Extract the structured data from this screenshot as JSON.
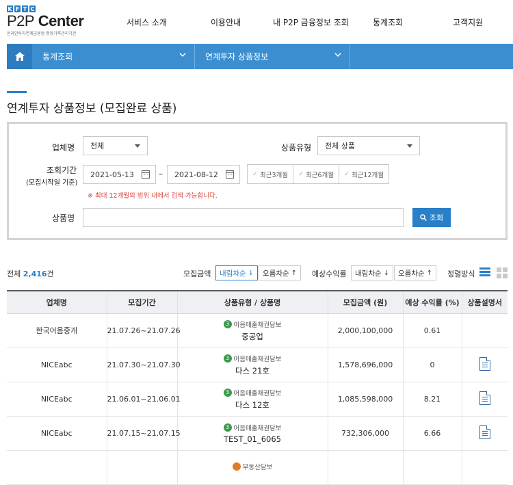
{
  "logo": {
    "top": "KFTC",
    "main_p2p": "P2P",
    "main_center": "Center",
    "sub": "온라인투자연계금융업 중앙기록관리기관"
  },
  "gnb": [
    "서비스 소개",
    "이용안내",
    "내 P2P 금융정보 조회",
    "통계조회",
    "고객지원"
  ],
  "subnav": {
    "menu1": "통계조회",
    "menu2": "연계투자 상품정보"
  },
  "page_title": "연계투자 상품정보 (모집완료 상품)",
  "search": {
    "company_label": "업체명",
    "company_value": "전체",
    "type_label": "상품유형",
    "type_value": "전체 상품",
    "period_label": "조회기간",
    "period_sub": "(모집시작일 기준)",
    "date_from": "2021-05-13",
    "date_sep": "–",
    "date_to": "2021-08-12",
    "quick": [
      "최근3개월",
      "최근6개월",
      "최근12개월"
    ],
    "notice": "※ 최대 12개월의 범위 내에서 검색 가능합니다.",
    "name_label": "상품명",
    "name_value": "",
    "button": "조회"
  },
  "toolbar": {
    "total_label": "전체",
    "total_count": "2,416",
    "total_unit": "건",
    "amount_label": "모집금액",
    "amount_desc": "내림차순",
    "amount_asc": "오름차순",
    "yield_label": "예상수익률",
    "yield_desc": "내림차순",
    "yield_asc": "오름차순",
    "sort_label": "정렬방식"
  },
  "table": {
    "headers": [
      "업체명",
      "모집기간",
      "상품유형 / 상품명",
      "모집금액 (원)",
      "예상 수익률 (%)",
      "상품설명서"
    ],
    "rows": [
      {
        "company": "한국어음중개",
        "period": "21.07.26~21.07.26",
        "type_no": "3",
        "type": "어음매출채권담보",
        "name": "중공업",
        "amount": "2,000,100,000",
        "yield": "0.61",
        "doc": false
      },
      {
        "company": "NICEabc",
        "period": "21.07.30~21.07.30",
        "type_no": "3",
        "type": "어음매출채권담보",
        "name": "다스 21호",
        "amount": "1,578,696,000",
        "yield": "0",
        "doc": true
      },
      {
        "company": "NICEabc",
        "period": "21.06.01~21.06.01",
        "type_no": "3",
        "type": "어음매출채권담보",
        "name": "다스 12호",
        "amount": "1,085,598,000",
        "yield": "8.21",
        "doc": true
      },
      {
        "company": "NICEabc",
        "period": "21.07.15~21.07.15",
        "type_no": "3",
        "type": "어음매출채권담보",
        "name": "TEST_01_6065",
        "amount": "732,306,000",
        "yield": "6.66",
        "doc": true
      },
      {
        "company": "",
        "period": "",
        "type_no": "",
        "type": "부동산담보",
        "name": "",
        "amount": "",
        "yield": "",
        "doc": false
      }
    ]
  }
}
